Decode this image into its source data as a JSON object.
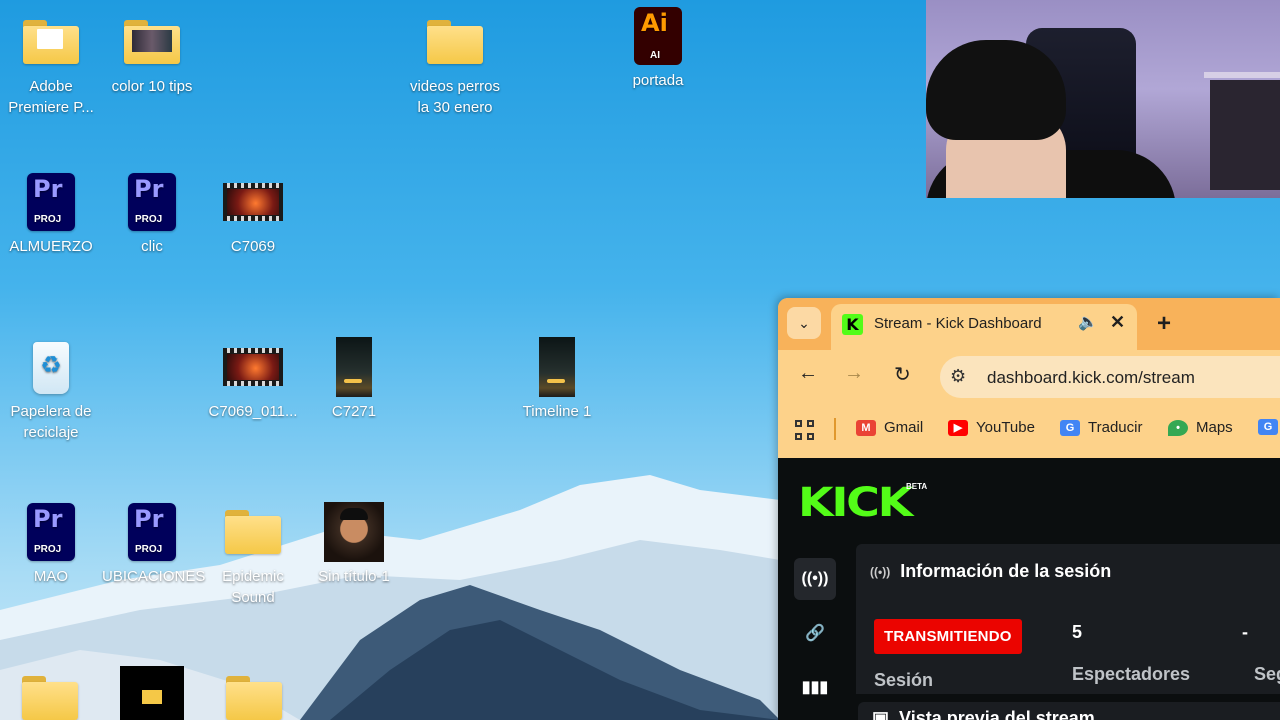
{
  "desktop": {
    "icons": [
      {
        "label": "Adobe Premiere P...",
        "type": "folder"
      },
      {
        "label": "color 10 tips",
        "type": "folder-thumb"
      },
      {
        "label": "videos perros la 30 enero",
        "type": "folder"
      },
      {
        "label": "portada",
        "type": "illustrator"
      },
      {
        "label": "ALMUERZO",
        "type": "premiere"
      },
      {
        "label": "clic",
        "type": "premiere"
      },
      {
        "label": "C7069",
        "type": "video"
      },
      {
        "label": "Papelera de reciclaje",
        "type": "recycle-bin"
      },
      {
        "label": "C7069_011...",
        "type": "video"
      },
      {
        "label": "C7271",
        "type": "video-portrait"
      },
      {
        "label": "Timeline 1",
        "type": "video-portrait"
      },
      {
        "label": "MAO",
        "type": "premiere"
      },
      {
        "label": "UBICACIONES",
        "type": "premiere"
      },
      {
        "label": "Epidemic Sound",
        "type": "folder"
      },
      {
        "label": "Sin título-1",
        "type": "photo"
      }
    ],
    "project_tag": "PROJ",
    "pr_text": "Pr",
    "ai_text": "Ai",
    "ai_tag": "AI"
  },
  "browser": {
    "tab": {
      "title": "Stream - Kick Dashboard",
      "favicon": "K"
    },
    "address": "dashboard.kick.com/stream",
    "bookmarks": [
      {
        "label": "Gmail",
        "icon": "gmail-icon",
        "color": "#ea4335"
      },
      {
        "label": "YouTube",
        "icon": "youtube-icon",
        "color": "#ff0000"
      },
      {
        "label": "Traducir",
        "icon": "translate-icon",
        "color": "#4285f4"
      },
      {
        "label": "Maps",
        "icon": "maps-icon",
        "color": "#34a853"
      }
    ]
  },
  "kick": {
    "logo": "KICK",
    "beta": "BETA",
    "session_title": "Información de la sesión",
    "status_badge": "TRANSMITIENDO",
    "viewers_value": "5",
    "viewers_label": "Espectadores",
    "followers_value": "-",
    "followers_label": "Segu",
    "session_label": "Sesión",
    "preview_title": "Vista previa del stream",
    "accent": "#53fc18",
    "live_color": "#eb0400"
  }
}
